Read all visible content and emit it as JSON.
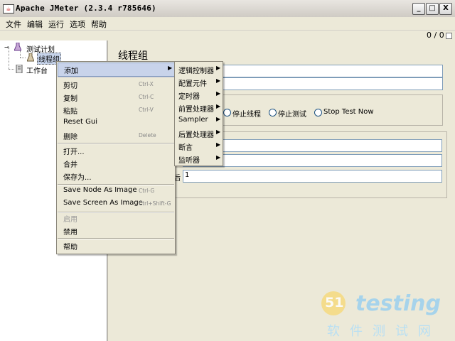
{
  "window": {
    "title": "Apache JMeter (2.3.4 r785646)",
    "app_icon": "jmeter-icon",
    "min_label": "_",
    "max_label": "□",
    "close_label": "X"
  },
  "menubar": {
    "items": [
      "文件",
      "编辑",
      "运行",
      "选项",
      "帮助"
    ]
  },
  "status": {
    "counter": "0 / 0"
  },
  "tree": {
    "items": [
      "测试计划",
      "线程组",
      "工作台"
    ]
  },
  "panel": {
    "title": "线程组",
    "loop_value": "1",
    "loop_label_tail": "后"
  },
  "radios": [
    "停止线程",
    "停止测试",
    "Stop Test Now"
  ],
  "context_menu": {
    "items": [
      {
        "label": "添加",
        "accel": "",
        "submenu": true
      },
      {
        "label": "剪切",
        "accel": "Ctrl-X"
      },
      {
        "label": "复制",
        "accel": "Ctrl-C"
      },
      {
        "label": "粘贴",
        "accel": "Ctrl-V"
      },
      {
        "label": "Reset Gui",
        "accel": ""
      },
      {
        "label": "删除",
        "accel": "Delete"
      },
      {
        "label": "打开...",
        "accel": ""
      },
      {
        "label": "合并",
        "accel": ""
      },
      {
        "label": "保存为...",
        "accel": ""
      },
      {
        "label": "Save Node As Image",
        "accel": "Ctrl-G"
      },
      {
        "label": "Save Screen As Image",
        "accel": "Ctrl+Shift-G"
      },
      {
        "label": "启用",
        "accel": ""
      },
      {
        "label": "禁用",
        "accel": ""
      },
      {
        "label": "帮助",
        "accel": ""
      }
    ],
    "arrow": "▶"
  },
  "submenu": {
    "items": [
      "逻辑控制器",
      "配置元件",
      "定时器",
      "前置处理器",
      "Sampler",
      "后置处理器",
      "断言",
      "监听器"
    ],
    "arrow": "▶"
  },
  "watermark": {
    "logo_num": "51",
    "logo_text": "testing",
    "subtitle": "软件测试网"
  }
}
